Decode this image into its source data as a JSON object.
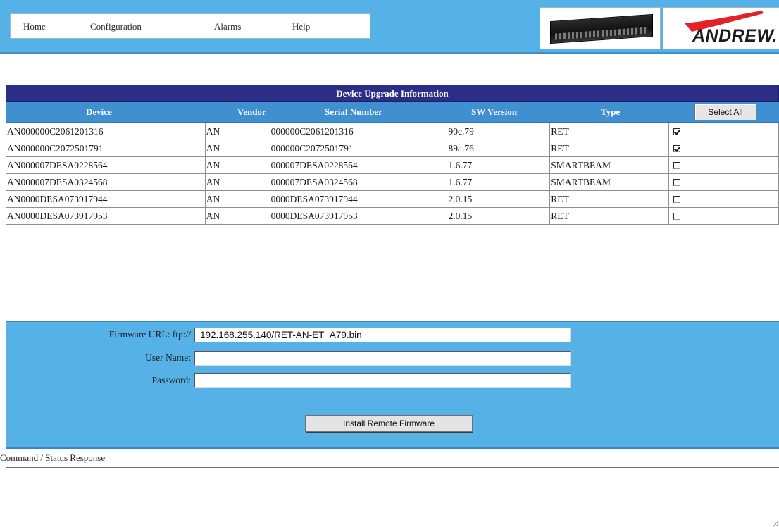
{
  "nav": {
    "items": [
      "Home",
      "Configuration",
      "Alarms",
      "Help"
    ]
  },
  "logo": {
    "brand": "ANDREW."
  },
  "table": {
    "title": "Device Upgrade Information",
    "columns": [
      "Device",
      "Vendor",
      "Serial Number",
      "SW Version",
      "Type"
    ],
    "select_all_label": "Select All",
    "rows": [
      {
        "device": "AN000000C2061201316",
        "vendor": "AN",
        "serial": "000000C2061201316",
        "sw_version": "90c.79",
        "type": "RET",
        "selected": true
      },
      {
        "device": "AN000000C2072501791",
        "vendor": "AN",
        "serial": "000000C2072501791",
        "sw_version": "89a.76",
        "type": "RET",
        "selected": true
      },
      {
        "device": "AN000007DESA0228564",
        "vendor": "AN",
        "serial": "000007DESA0228564",
        "sw_version": "1.6.77",
        "type": "SMARTBEAM",
        "selected": false
      },
      {
        "device": "AN000007DESA0324568",
        "vendor": "AN",
        "serial": "000007DESA0324568",
        "sw_version": "1.6.77",
        "type": "SMARTBEAM",
        "selected": false
      },
      {
        "device": "AN0000DESA073917944",
        "vendor": "AN",
        "serial": "0000DESA073917944",
        "sw_version": "2.0.15",
        "type": "RET",
        "selected": false
      },
      {
        "device": "AN0000DESA073917953",
        "vendor": "AN",
        "serial": "0000DESA073917953",
        "sw_version": "2.0.15",
        "type": "RET",
        "selected": false
      }
    ]
  },
  "firmware": {
    "url_label": "Firmware URL: ftp://",
    "url_value": "192.168.255.140/RET-AN-ET_A79.bin",
    "username_label": "User Name:",
    "username_value": "",
    "password_label": "Password:",
    "password_value": "",
    "install_label": "Install Remote Firmware"
  },
  "status": {
    "label": "Command / Status Response",
    "value": ""
  },
  "colors": {
    "header_blue": "#56b1e6",
    "title_navy": "#2b2e86",
    "column_header_blue": "#3f8fd1"
  }
}
